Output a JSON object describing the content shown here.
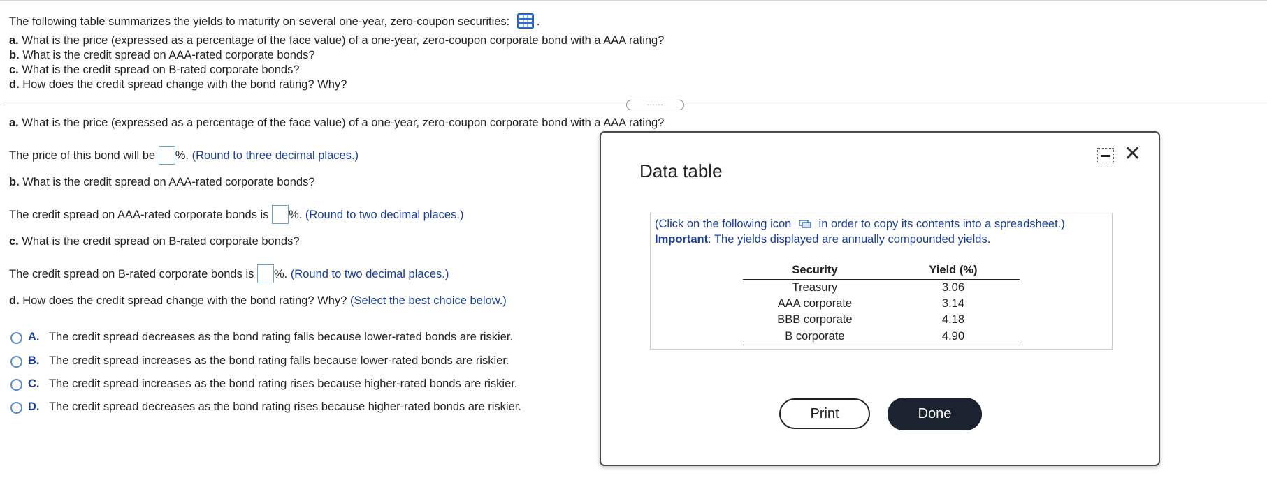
{
  "intro": "The following table summarizes the yields to maturity on several one-year, zero-coupon securities:",
  "intro_end": ".",
  "questions": [
    {
      "letter": "a.",
      "text": "What is the price (expressed as a percentage of the face value) of a one-year, zero-coupon corporate bond with a AAA rating?"
    },
    {
      "letter": "b.",
      "text": "What is the credit spread on AAA-rated corporate bonds?"
    },
    {
      "letter": "c.",
      "text": "What is the credit spread on B-rated corporate bonds?"
    },
    {
      "letter": "d.",
      "text": "How does the credit spread change with the bond rating? Why?"
    }
  ],
  "divider_handle": "......",
  "parts": {
    "a": {
      "letter": "a.",
      "question": "What is the price (expressed as a percentage of the face value) of a one-year, zero-coupon corporate bond with a AAA rating?",
      "prefix": "The price of this bond will be",
      "suffix": "%.",
      "hint": "(Round to three decimal places.)",
      "value": ""
    },
    "b": {
      "letter": "b.",
      "question": "What is the credit spread on AAA-rated corporate bonds?",
      "prefix": "The credit spread on AAA-rated corporate bonds is",
      "suffix": "%.",
      "hint": "(Round to two decimal places.)",
      "value": ""
    },
    "c": {
      "letter": "c.",
      "question": "What is the credit spread on B-rated corporate bonds?",
      "prefix": "The credit spread on B-rated corporate bonds is",
      "suffix": "%.",
      "hint": "(Round to two decimal places.)",
      "value": ""
    },
    "d": {
      "letter": "d.",
      "question": "How does the credit spread change with the bond rating? Why?",
      "hint": "(Select the best choice below.)"
    }
  },
  "choices": [
    {
      "letter": "A.",
      "text": "The credit spread decreases as the bond rating falls because lower-rated bonds are riskier."
    },
    {
      "letter": "B.",
      "text": "The credit spread increases as the bond rating falls because lower-rated bonds are riskier."
    },
    {
      "letter": "C.",
      "text": "The credit spread increases as the bond rating rises because higher-rated bonds are riskier."
    },
    {
      "letter": "D.",
      "text": "The credit spread decreases as the bond rating rises because higher-rated bonds are riskier."
    }
  ],
  "dialog": {
    "title": "Data table",
    "instruction_pre": "(Click on the following icon",
    "instruction_post": "in order to copy its contents into a spreadsheet.)",
    "important_label": "Important",
    "important_text": ": The yields displayed are annually compounded yields.",
    "table": {
      "headers": [
        "Security",
        "Yield (%)"
      ],
      "rows": [
        [
          "Treasury",
          "3.06"
        ],
        [
          "AAA corporate",
          "3.14"
        ],
        [
          "BBB corporate",
          "4.18"
        ],
        [
          "B corporate",
          "4.90"
        ]
      ]
    },
    "print_label": "Print",
    "done_label": "Done"
  },
  "colors": {
    "accent_blue": "#1a3d9a",
    "radio_border": "#5a8bc0",
    "done_button": "#1b2331"
  }
}
